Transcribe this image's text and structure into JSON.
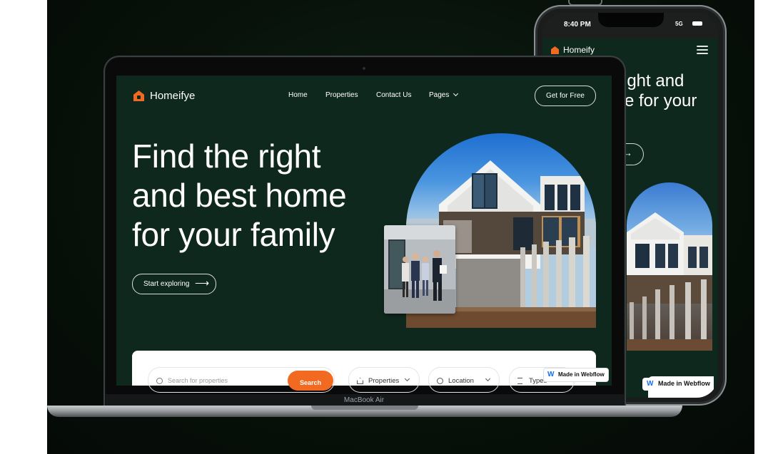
{
  "phone": {
    "status_time": "8:40 PM",
    "status_signal": "5G",
    "brand": "Homeify",
    "hero_line1": "ight and",
    "hero_line2": "e for your",
    "explore_arrow": "→",
    "webflow_badge": "Made in Webflow",
    "webflow_mark": "W"
  },
  "laptop": {
    "model_label": "MacBook Air",
    "brand": "Homeifye",
    "nav": {
      "home": "Home",
      "properties": "Properties",
      "contact": "Contact Us",
      "pages": "Pages"
    },
    "cta_label": "Get for Free",
    "hero": {
      "line1": "Find the right",
      "line2": "and best home",
      "line3": "for your family"
    },
    "explore_label": "Start exploring",
    "explore_arrow": "⟶",
    "search": {
      "placeholder": "Search for properties",
      "button_label": "Search"
    },
    "filters": {
      "properties": "Properties",
      "location": "Location",
      "types": "Types"
    },
    "webflow_badge": "Made in Webflow",
    "webflow_mark": "W"
  },
  "colors": {
    "brand_green": "#0f281d",
    "accent_orange": "#f26a21",
    "webflow_blue": "#146ef5"
  },
  "icons": [
    "home-logo-icon",
    "chevron-down-icon",
    "arrow-right-icon",
    "search-icon",
    "home-icon",
    "location-pin-icon",
    "types-icon",
    "menu-icon",
    "webflow-icon"
  ]
}
